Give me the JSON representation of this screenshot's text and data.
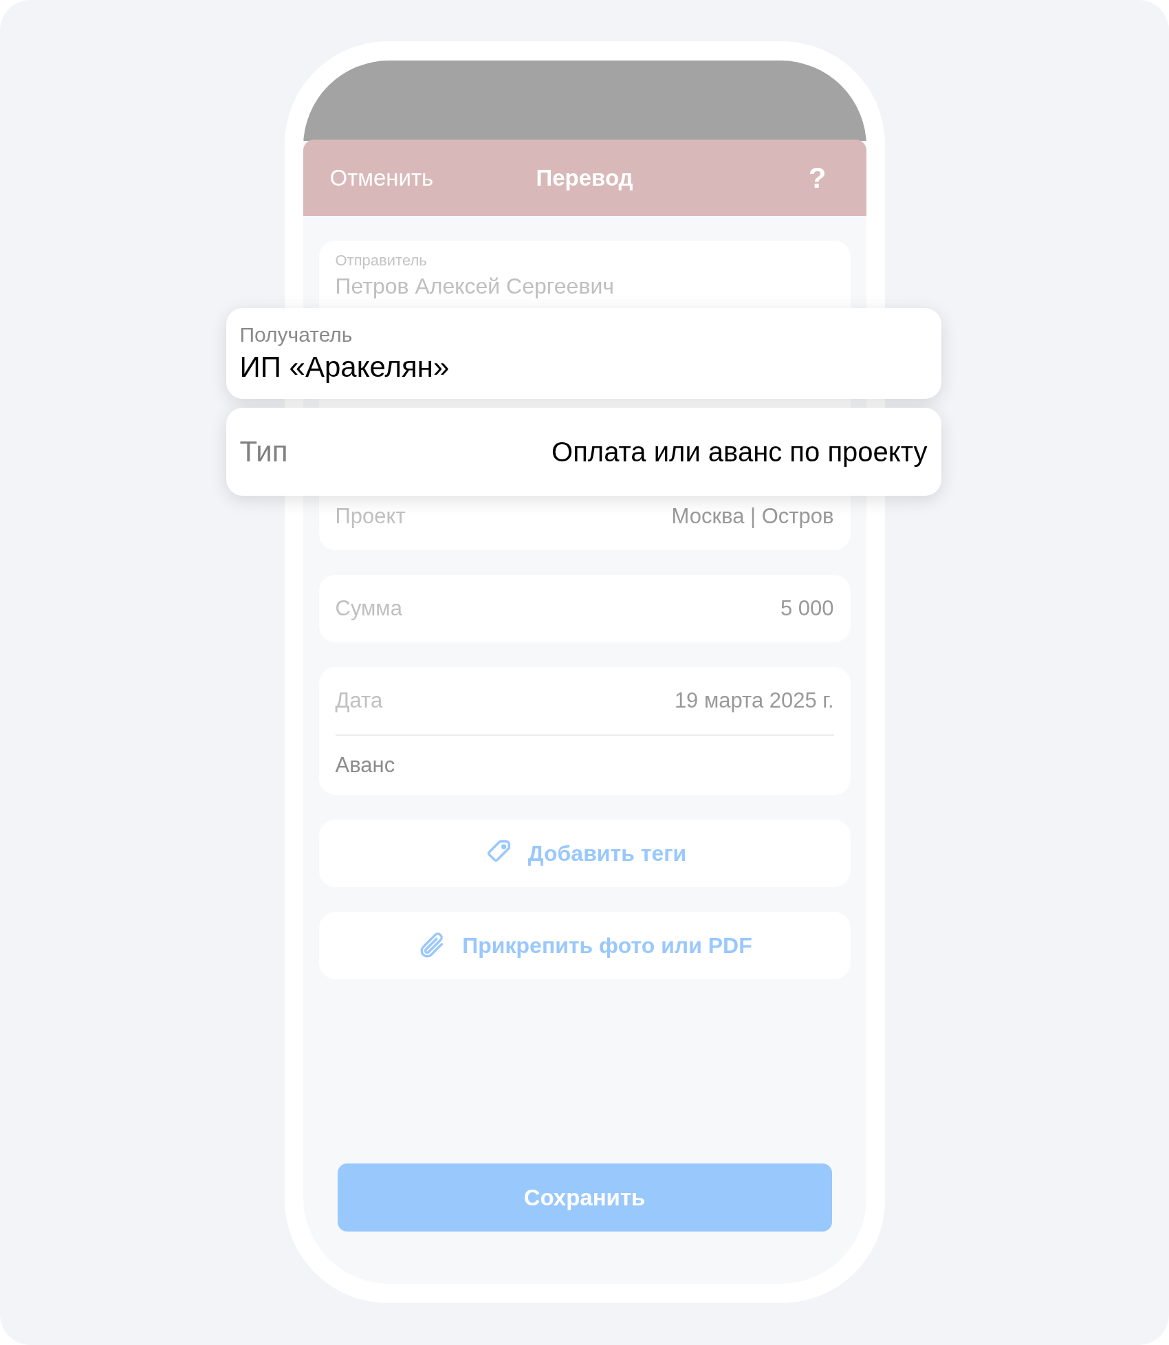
{
  "header": {
    "cancel": "Отменить",
    "title": "Перевод",
    "help": "?"
  },
  "sender": {
    "label": "Отправитель",
    "value": "Петров Алексей Сергеевич"
  },
  "recipient": {
    "label": "Получатель",
    "value": "ИП «Аракелян»"
  },
  "type": {
    "label": "Тип",
    "value": "Оплата или аванс по проекту"
  },
  "project": {
    "label": "Проект",
    "value": "Москва | Остров"
  },
  "amount": {
    "label": "Сумма",
    "value": "5 000"
  },
  "date": {
    "label": "Дата",
    "value": "19 марта 2025 г.",
    "note": "Аванс"
  },
  "actions": [
    {
      "kind": "tag",
      "label": "Добавить теги"
    },
    {
      "kind": "attach",
      "label": "Прикрепить фото или PDF"
    }
  ],
  "save_button": "Сохранить"
}
